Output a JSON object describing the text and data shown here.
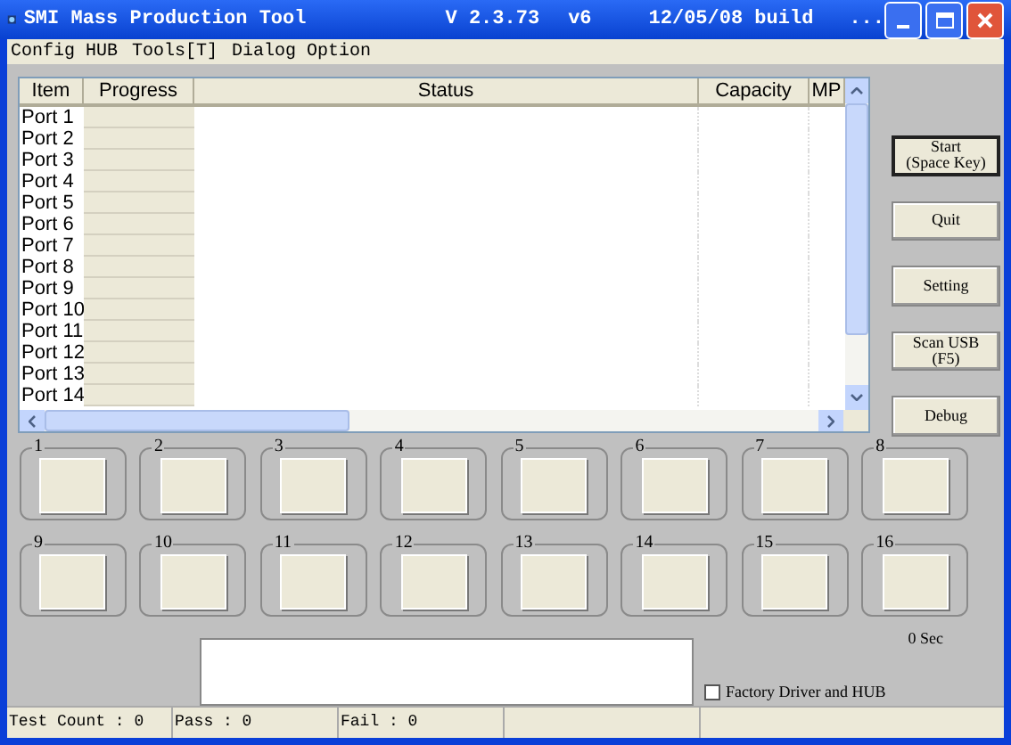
{
  "window": {
    "title": "SMI Mass Production Tool",
    "version": "V 2.3.73",
    "variant": "v6",
    "build": "12/05/08 build",
    "ellipsis": "..."
  },
  "menu": [
    "Config HUB",
    "Tools[T]",
    "Dialog Option"
  ],
  "table": {
    "columns": [
      "Item",
      "Progress",
      "Status",
      "Capacity",
      "MP"
    ],
    "rows": [
      {
        "item": "Port 1",
        "level": 0
      },
      {
        "item": "Port 2",
        "level": 0
      },
      {
        "item": "Port 3",
        "level": 0
      },
      {
        "item": "Port 4",
        "level": 0
      },
      {
        "item": "Port 5",
        "level": 0
      },
      {
        "item": "Port 6",
        "level": 0
      },
      {
        "item": "Port 7",
        "level": 0
      },
      {
        "item": "Port 8",
        "level": 0
      },
      {
        "item": "Port 9",
        "level": 0
      },
      {
        "item": "Port 10",
        "level": 0
      },
      {
        "item": "Port 11",
        "level": 0
      },
      {
        "item": "Port 12",
        "level": 0
      },
      {
        "item": "Port 13",
        "level": 0
      },
      {
        "item": "Port 14",
        "level": 0
      }
    ]
  },
  "buttons": [
    {
      "lines": [
        "Start",
        "(Space Key)"
      ],
      "default": true
    },
    {
      "lines": [
        "Quit"
      ],
      "default": false
    },
    {
      "lines": [
        "Setting"
      ],
      "default": false
    },
    {
      "lines": [
        "Scan USB",
        "(F5)"
      ],
      "default": false
    },
    {
      "lines": [
        "Debug"
      ],
      "default": false
    }
  ],
  "ports": [
    "1",
    "2",
    "3",
    "4",
    "5",
    "6",
    "7",
    "8",
    "9",
    "10",
    "11",
    "12",
    "13",
    "14",
    "15",
    "16"
  ],
  "timer": "0 Sec",
  "factory_checkbox": {
    "label": "Factory Driver and HUB",
    "checked": false
  },
  "status_bar": [
    "Test Count : 0",
    "Pass : 0",
    "Fail : 0"
  ]
}
